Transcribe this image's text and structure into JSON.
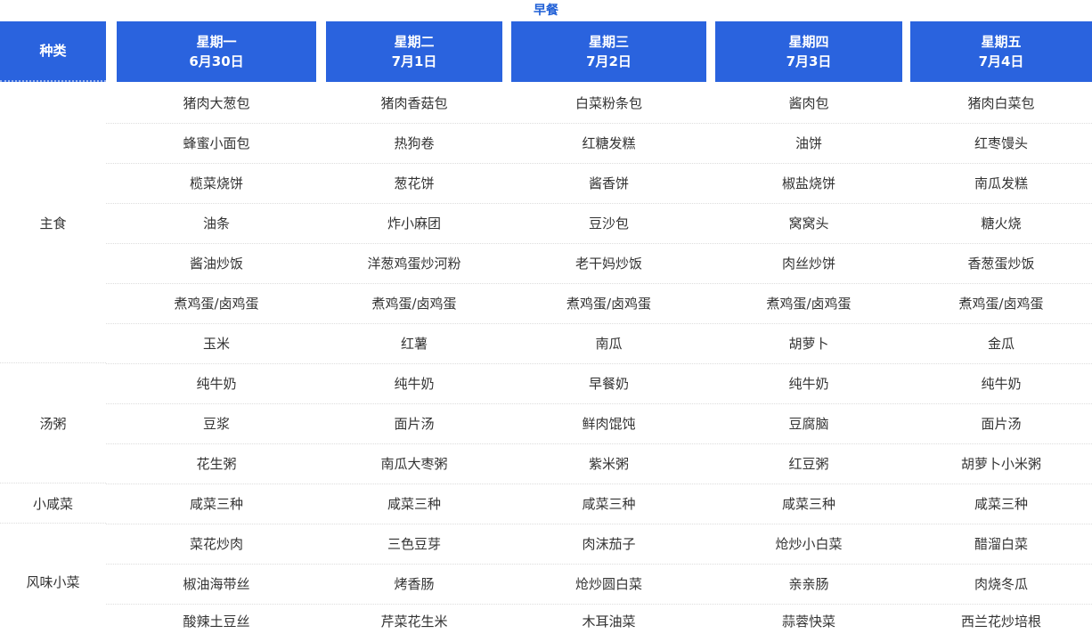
{
  "title": "早餐",
  "category_header": "种类",
  "days": [
    {
      "weekday": "星期一",
      "date": "6月30日"
    },
    {
      "weekday": "星期二",
      "date": "7月1日"
    },
    {
      "weekday": "星期三",
      "date": "7月2日"
    },
    {
      "weekday": "星期四",
      "date": "7月3日"
    },
    {
      "weekday": "星期五",
      "date": "7月4日"
    }
  ],
  "groups": [
    {
      "name": "主食"
    },
    {
      "name": "汤粥"
    },
    {
      "name": "小咸菜"
    },
    {
      "name": "风味小菜"
    }
  ],
  "rows": [
    [
      "猪肉大葱包",
      "猪肉香菇包",
      "白菜粉条包",
      "酱肉包",
      "猪肉白菜包"
    ],
    [
      "蜂蜜小面包",
      "热狗卷",
      "红糖发糕",
      "油饼",
      "红枣馒头"
    ],
    [
      "榄菜烧饼",
      "葱花饼",
      "酱香饼",
      "椒盐烧饼",
      "南瓜发糕"
    ],
    [
      "油条",
      "炸小麻团",
      "豆沙包",
      "窝窝头",
      "糖火烧"
    ],
    [
      "酱油炒饭",
      "洋葱鸡蛋炒河粉",
      "老干妈炒饭",
      "肉丝炒饼",
      "香葱蛋炒饭"
    ],
    [
      "煮鸡蛋/卤鸡蛋",
      "煮鸡蛋/卤鸡蛋",
      "煮鸡蛋/卤鸡蛋",
      "煮鸡蛋/卤鸡蛋",
      "煮鸡蛋/卤鸡蛋"
    ],
    [
      "玉米",
      "红薯",
      "南瓜",
      "胡萝卜",
      "金瓜"
    ],
    [
      "纯牛奶",
      "纯牛奶",
      "早餐奶",
      "纯牛奶",
      "纯牛奶"
    ],
    [
      "豆浆",
      "面片汤",
      "鲜肉馄饨",
      "豆腐脑",
      "面片汤"
    ],
    [
      "花生粥",
      "南瓜大枣粥",
      "紫米粥",
      "红豆粥",
      "胡萝卜小米粥"
    ],
    [
      "咸菜三种",
      "咸菜三种",
      "咸菜三种",
      "咸菜三种",
      "咸菜三种"
    ],
    [
      "菜花炒肉",
      "三色豆芽",
      "肉沫茄子",
      "炝炒小白菜",
      "醋溜白菜"
    ],
    [
      "椒油海带丝",
      "烤香肠",
      "炝炒圆白菜",
      "亲亲肠",
      "肉烧冬瓜"
    ],
    [
      "酸辣土豆丝",
      "芹菜花生米",
      "木耳油菜",
      "蒜蓉快菜",
      "西兰花炒培根"
    ]
  ]
}
